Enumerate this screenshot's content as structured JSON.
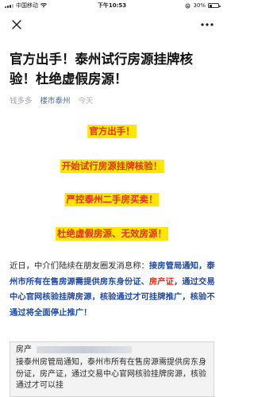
{
  "status_bar": {
    "carrier": "中国移动",
    "time": "下午10:53",
    "battery": "30%",
    "battery_level": 0.3
  },
  "nav": {
    "close_icon": "close-icon",
    "more_icon": "more-icon"
  },
  "article": {
    "title": "官方出手！泰州试行房源挂牌核验！杜绝虚假房源！",
    "author": "钱多多",
    "account": "楼市泰州",
    "date": "今天"
  },
  "highlights": [
    "官方出手！",
    "开始试行房源挂牌核验！",
    "严控泰州二手房买卖！",
    "杜绝虚假房源、无效房源！"
  ],
  "paragraph": {
    "p1": "近日，中介们陆续在朋友圈发消息称：",
    "p2": "接房管局通知，泰州市所有在售房源需提供房东身份证、",
    "p3": "房产证",
    "p4": "，通过交易中心官网核验挂牌房源，核验通过才可挂牌推广，核验不通过将全面停止推广！"
  },
  "card": {
    "head": "房产",
    "body": "接泰州房管局通知，泰州市所有在售房源需提供房东身份证，房产证，通过交易中心官网核验挂牌房源，核验通过才可以挂"
  },
  "colors": {
    "highlight_bg": "#ffe600",
    "highlight_text": "#e03018",
    "link_blue": "#1f4aa8",
    "account_blue": "#4a6a9a"
  }
}
